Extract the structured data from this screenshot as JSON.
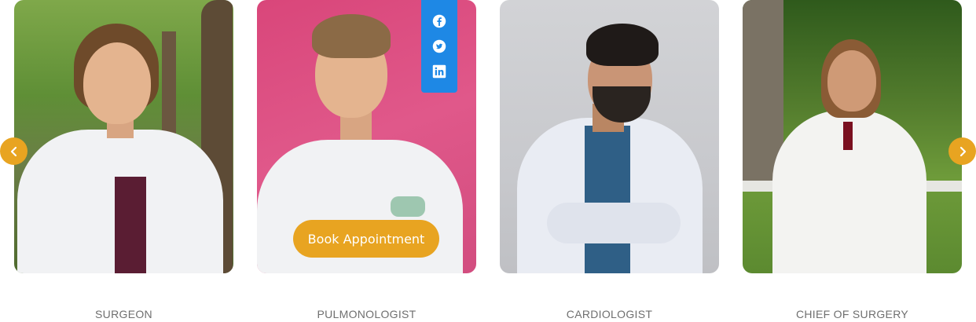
{
  "cards": [
    {
      "role": "SURGEON"
    },
    {
      "role": "PULMONOLOGIST",
      "book_label": "Book Appointment"
    },
    {
      "role": "CARDIOLOGIST"
    },
    {
      "role": "CHIEF OF SURGERY"
    }
  ],
  "social_icons": [
    "facebook-icon",
    "twitter-icon",
    "linkedin-icon"
  ],
  "nav": {
    "prev_icon": "chevron-left-icon",
    "next_icon": "chevron-right-icon"
  },
  "colors": {
    "accent": "#e8a421",
    "social": "#1e88e5",
    "role_text": "#6f6f6f"
  }
}
